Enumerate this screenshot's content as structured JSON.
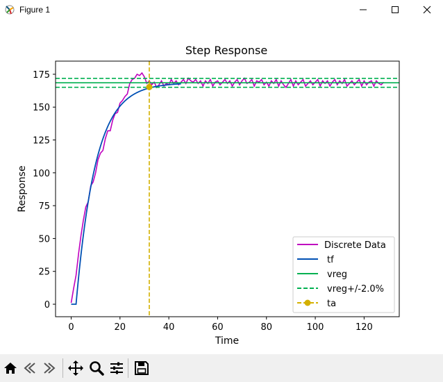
{
  "window": {
    "title": "Figure 1",
    "controls": [
      "minimize",
      "maximize",
      "close"
    ]
  },
  "toolbar": {
    "buttons": [
      {
        "name": "home-icon",
        "label": "Home"
      },
      {
        "name": "back-icon",
        "label": "Back"
      },
      {
        "name": "forward-icon",
        "label": "Forward"
      },
      {
        "name": "pan-icon",
        "label": "Pan"
      },
      {
        "name": "zoom-icon",
        "label": "Zoom"
      },
      {
        "name": "configure-subplots-icon",
        "label": "Configure subplots"
      },
      {
        "name": "save-icon",
        "label": "Save"
      }
    ]
  },
  "chart_data": {
    "type": "line",
    "title": "Step Response",
    "xlabel": "Time",
    "ylabel": "Response",
    "xlim": [
      -6.4,
      134.4
    ],
    "ylim": [
      -9.5,
      185
    ],
    "xticks": [
      0,
      20,
      40,
      60,
      80,
      100,
      120
    ],
    "yticks": [
      0,
      25,
      50,
      75,
      100,
      125,
      150,
      175
    ],
    "grid": false,
    "legend_position": "lower right",
    "colors": {
      "discrete": "#bf00bf",
      "tf": "#0050b4",
      "vreg": "#00b050",
      "ta": "#d4b000"
    },
    "legend": [
      "Discrete Data",
      "tf",
      "vreg",
      "vreg+/-2.0%",
      "ta"
    ],
    "discrete_data": {
      "x": [
        0,
        1,
        2,
        3,
        4,
        5,
        6,
        7,
        8,
        9,
        10,
        11,
        12,
        13,
        14,
        15,
        16,
        17,
        18,
        19,
        20,
        21,
        22,
        23,
        24,
        25,
        26,
        27,
        28,
        29,
        30,
        31,
        32,
        33,
        34,
        35,
        36,
        37,
        38,
        39,
        40,
        41,
        42,
        43,
        44,
        45,
        46,
        47,
        48,
        49,
        50,
        51,
        52,
        53,
        54,
        55,
        56,
        57,
        58,
        59,
        60,
        61,
        62,
        63,
        64,
        65,
        66,
        67,
        68,
        69,
        70,
        71,
        72,
        73,
        74,
        75,
        76,
        77,
        78,
        79,
        80,
        81,
        82,
        83,
        84,
        85,
        86,
        87,
        88,
        89,
        90,
        91,
        92,
        93,
        94,
        95,
        96,
        97,
        98,
        99,
        100,
        101,
        102,
        103,
        104,
        105,
        106,
        107,
        108,
        109,
        110,
        111,
        112,
        113,
        114,
        115,
        116,
        117,
        118,
        119,
        120,
        121,
        122,
        123,
        124,
        125,
        126,
        127,
        128
      ],
      "y": [
        1,
        12,
        22,
        38,
        52,
        64,
        74,
        78,
        90,
        93,
        100,
        110,
        115,
        117,
        126,
        132,
        132,
        140,
        145,
        146,
        153,
        155,
        158,
        160,
        168,
        171,
        172,
        175,
        174,
        176,
        173,
        168,
        170,
        167,
        169,
        165,
        167,
        170,
        166,
        168,
        167,
        171,
        168,
        170,
        167,
        169,
        171,
        168,
        172,
        170,
        169,
        171,
        168,
        170,
        166,
        170,
        168,
        171,
        166,
        169,
        170,
        167,
        169,
        171,
        168,
        170,
        166,
        169,
        171,
        167,
        170,
        172,
        168,
        169,
        171,
        166,
        170,
        169,
        171,
        167,
        169,
        166,
        170,
        168,
        171,
        166,
        170,
        167,
        165,
        168,
        171,
        166,
        170,
        167,
        169,
        171,
        166,
        168,
        170,
        167,
        169,
        171,
        166,
        170,
        168,
        170,
        166,
        169,
        171,
        167,
        170,
        168,
        171,
        166,
        168,
        170,
        167,
        169,
        171,
        166,
        170,
        167,
        169,
        170,
        166,
        170,
        168,
        167,
        169
      ]
    },
    "tf": {
      "delay": 2,
      "time_constant": 8,
      "final_value": 168.5,
      "x_start": 0,
      "x_end": 45
    },
    "vreg": 168.5,
    "vreg_band": [
      165.1,
      171.9
    ],
    "ta": {
      "x": 32,
      "y": 165.3
    }
  }
}
